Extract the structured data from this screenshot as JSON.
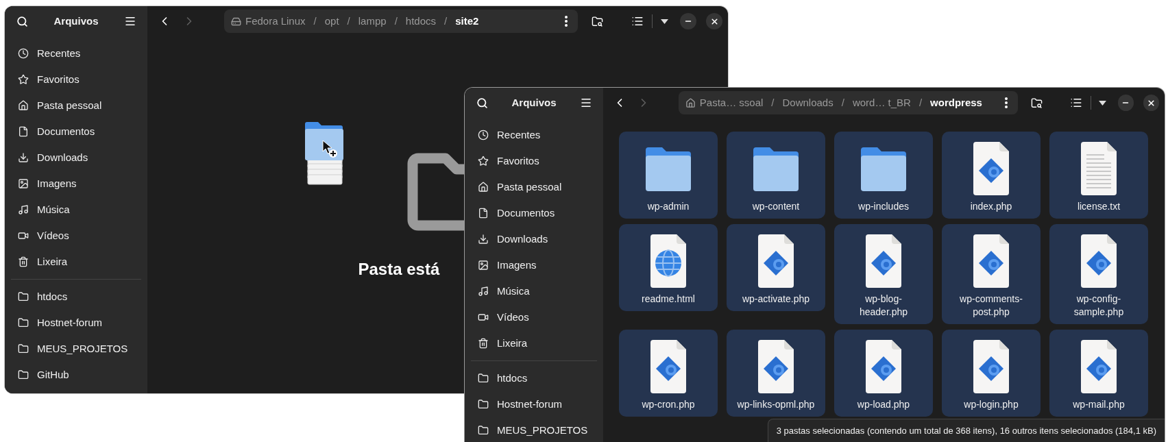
{
  "back_window": {
    "title": "Arquivos",
    "forward_disabled": true,
    "path": [
      {
        "label": "Fedora Linux",
        "selected": false
      },
      {
        "label": "opt",
        "selected": false
      },
      {
        "label": "lampp",
        "selected": false
      },
      {
        "label": "htdocs",
        "selected": false
      },
      {
        "label": "site2",
        "selected": true
      }
    ],
    "path_separator": "/",
    "places": [
      "Recentes",
      "Favoritos",
      "Pasta pessoal",
      "Documentos",
      "Downloads",
      "Imagens",
      "Música",
      "Vídeos",
      "Lixeira"
    ],
    "bookmarks": [
      "htdocs",
      "Hostnet-forum",
      "MEUS_PROJETOS",
      "GitHub"
    ],
    "empty_state": {
      "title": "Pasta está"
    }
  },
  "front_window": {
    "title": "Arquivos",
    "forward_disabled": true,
    "path": [
      {
        "label": "Pasta… ssoal",
        "selected": false
      },
      {
        "label": "Downloads",
        "selected": false
      },
      {
        "label": "word… t_BR",
        "selected": false
      },
      {
        "label": "wordpress",
        "selected": true
      }
    ],
    "path_separator": "/",
    "places": [
      "Recentes",
      "Favoritos",
      "Pasta pessoal",
      "Documentos",
      "Downloads",
      "Imagens",
      "Música",
      "Vídeos",
      "Lixeira"
    ],
    "bookmarks": [
      "htdocs",
      "Hostnet-forum",
      "MEUS_PROJETOS"
    ],
    "files": [
      {
        "name": "wp-admin",
        "kind": "folder",
        "selected": true
      },
      {
        "name": "wp-content",
        "kind": "folder",
        "selected": true
      },
      {
        "name": "wp-includes",
        "kind": "folder",
        "selected": true
      },
      {
        "name": "index.php",
        "kind": "php",
        "selected": true
      },
      {
        "name": "license.txt",
        "kind": "text",
        "selected": true
      },
      {
        "name": "readme.html",
        "kind": "html",
        "selected": true
      },
      {
        "name": "wp-activate.php",
        "kind": "php",
        "selected": true
      },
      {
        "name": "wp-blog-header.php",
        "kind": "php",
        "selected": true
      },
      {
        "name": "wp-comments-post.php",
        "kind": "php",
        "selected": true
      },
      {
        "name": "wp-config-sample.php",
        "kind": "php",
        "selected": true
      },
      {
        "name": "wp-cron.php",
        "kind": "php",
        "selected": true
      },
      {
        "name": "wp-links-opml.php",
        "kind": "php",
        "selected": true
      },
      {
        "name": "wp-load.php",
        "kind": "php",
        "selected": true
      },
      {
        "name": "wp-login.php",
        "kind": "php",
        "selected": true
      },
      {
        "name": "wp-mail.php",
        "kind": "php",
        "selected": true
      }
    ],
    "status_bar": "3 pastas selecionadas (contendo um total de 368 itens), 16 outros itens selecionados (184,1 kB)"
  }
}
